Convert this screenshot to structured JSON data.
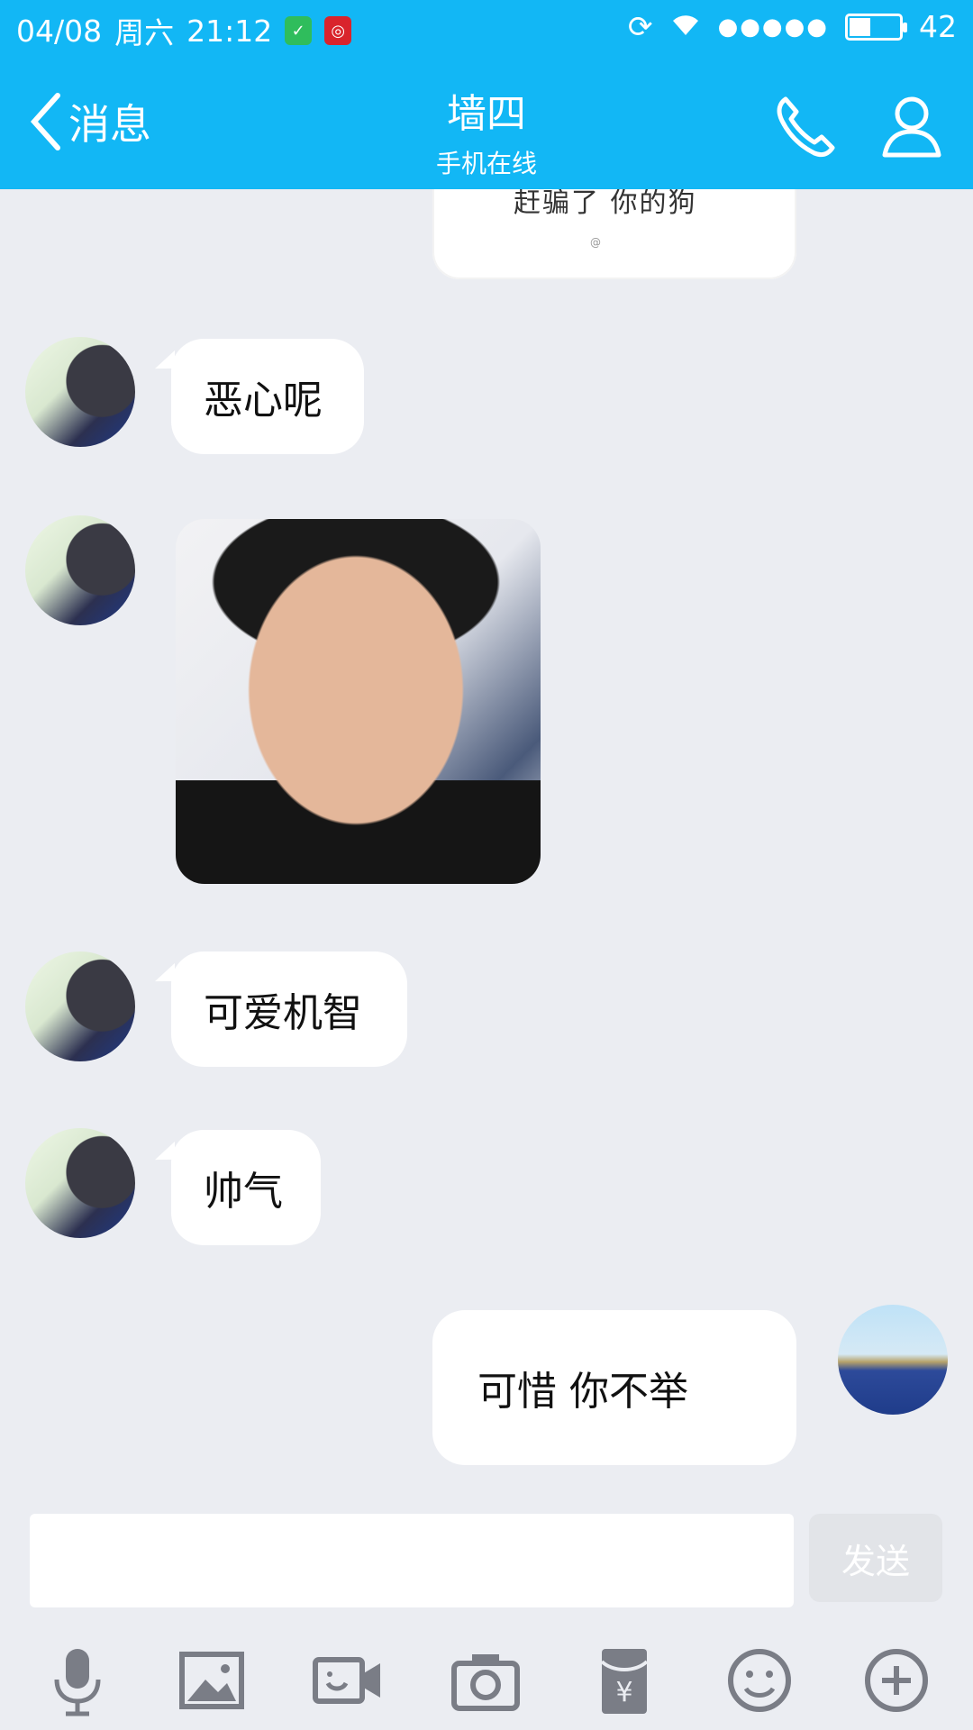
{
  "status": {
    "date": "04/08",
    "weekday": "周六",
    "time": "21:12",
    "battery_level": 42,
    "battery_text": "42"
  },
  "header": {
    "back_label": "消息",
    "title": "墙四",
    "subtitle": "手机在线"
  },
  "messages": [
    {
      "sender": "other",
      "type": "text",
      "text": "恶心呢"
    },
    {
      "sender": "other",
      "type": "image",
      "alt": "smiling man photo"
    },
    {
      "sender": "other",
      "type": "text",
      "text": "可爱机智"
    },
    {
      "sender": "other",
      "type": "text",
      "text": "帅气"
    },
    {
      "sender": "me",
      "type": "text",
      "text": "可惜 你不举"
    }
  ],
  "top_partial_image_text": "赶骗了 你的狗",
  "input": {
    "value": "",
    "send_label": "发送"
  },
  "toolbar_icons": [
    "microphone-icon",
    "image-icon",
    "video-icon",
    "camera-icon",
    "red-packet-icon",
    "emoji-icon",
    "plus-icon"
  ],
  "colors": {
    "accent": "#12b7f5",
    "chat_bg": "#ebedf2",
    "bubble": "#ffffff"
  }
}
